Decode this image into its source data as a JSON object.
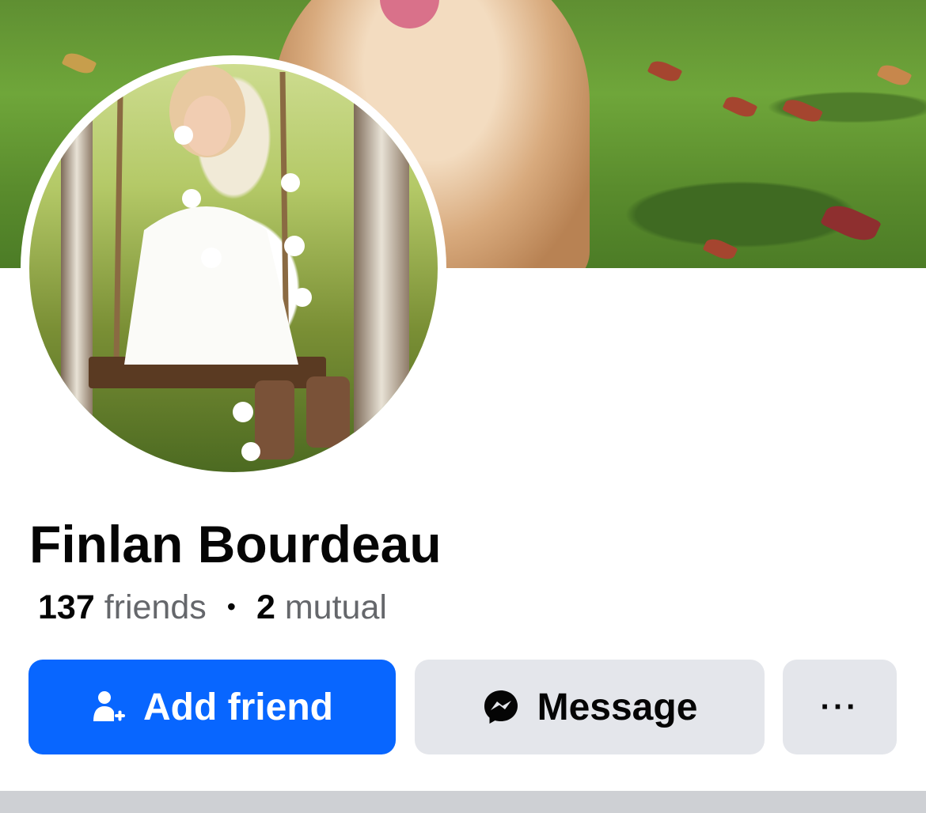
{
  "profile": {
    "name": "Finlan Bourdeau",
    "friends_count": "137",
    "friends_label": "friends",
    "separator": "•",
    "mutual_count": "2",
    "mutual_label": "mutual"
  },
  "actions": {
    "add_friend_label": "Add friend",
    "add_friend_icon": "add-friend-icon",
    "message_label": "Message",
    "message_icon": "messenger-icon",
    "more_label": "···"
  },
  "colors": {
    "primary": "#0866ff",
    "secondary_button": "#e4e6eb",
    "text_primary": "#050505",
    "text_secondary": "#65676b"
  }
}
